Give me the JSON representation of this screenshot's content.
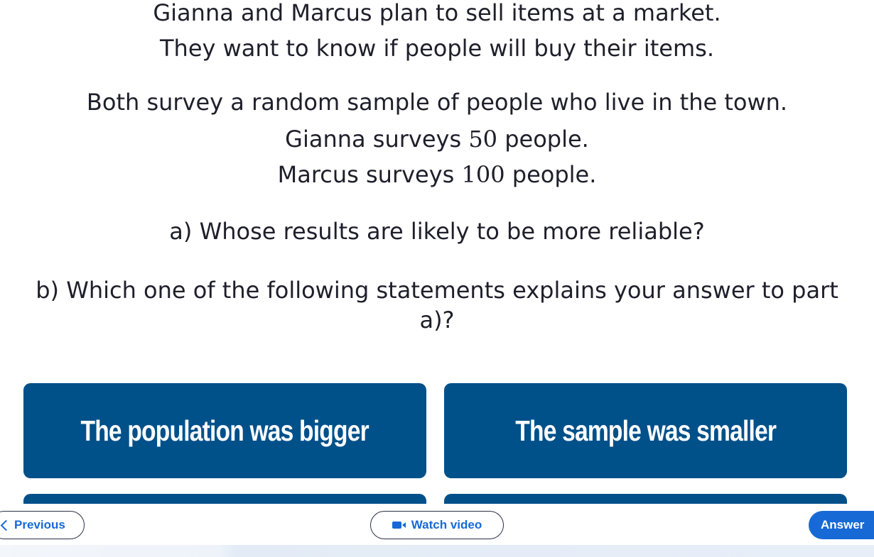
{
  "question": {
    "line1": "Gianna and Marcus plan to sell items at a market.",
    "line2": "They want to know if people will buy their items.",
    "line3": "Both survey a random sample of people who live in the town.",
    "line4_prefix": "Gianna surveys",
    "line4_number": "50",
    "line4_suffix": "people.",
    "line5_prefix": "Marcus surveys",
    "line5_number": "100",
    "line5_suffix": "people.",
    "part_a": "a) Whose results are likely to be more reliable?",
    "part_b_line1": "b) Which one of the following statements explains your answer to part",
    "part_b_line2": "a)?"
  },
  "options": [
    {
      "label": "The population was bigger"
    },
    {
      "label": "The sample was smaller"
    },
    {
      "label": ""
    },
    {
      "label": ""
    }
  ],
  "navigation": {
    "previous_label": "Previous",
    "video_label": "Watch video",
    "answer_label": "Answer"
  },
  "colors": {
    "option_background": "#00508a",
    "accent_blue": "#1769d6",
    "text_dark": "#1f1f2b"
  },
  "icons": {
    "previous": "chevron-left-icon",
    "video": "video-camera-icon"
  }
}
